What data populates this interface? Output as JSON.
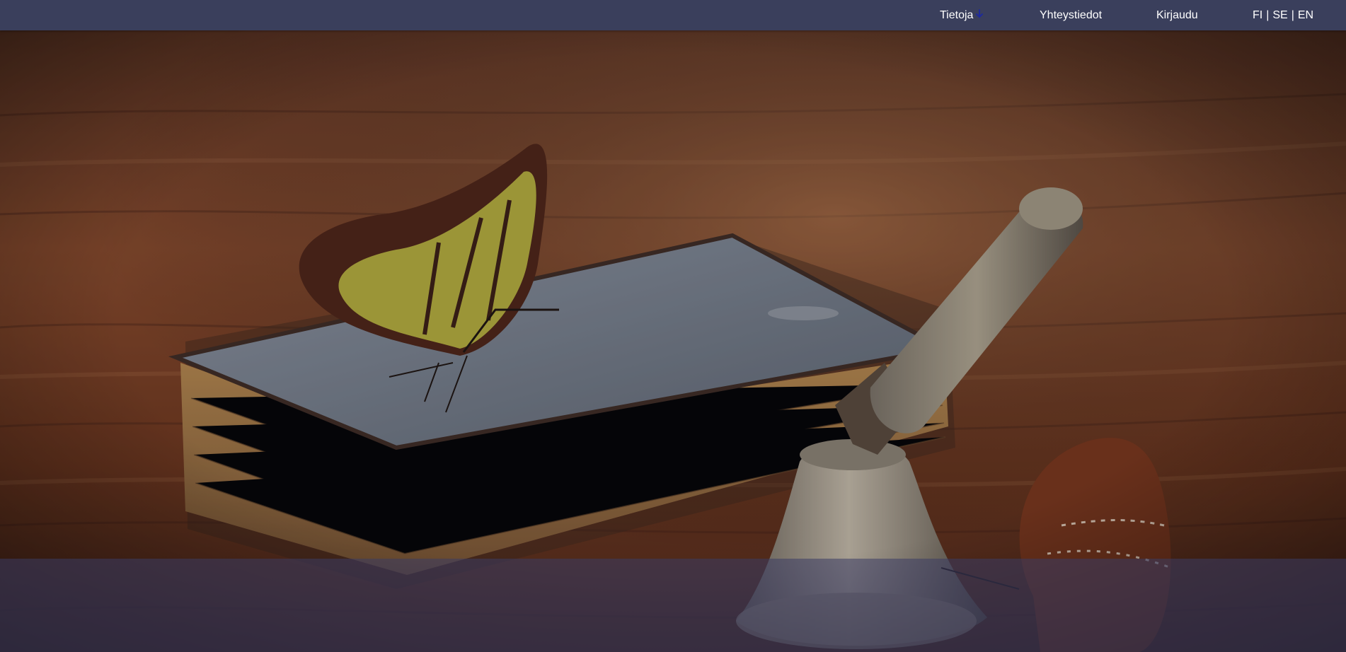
{
  "nav": {
    "items": [
      {
        "label": "Tietoja",
        "icon": "arrow-down-icon"
      },
      {
        "label": "Yhteystiedot"
      },
      {
        "label": "Kirjaudu"
      }
    ],
    "languages": [
      "FI",
      "SE",
      "EN"
    ],
    "language_separator": "|"
  },
  "colors": {
    "topbar": "#3a3f5c",
    "nav_text": "#ffffff",
    "icon_accent": "#1e2a9c",
    "footer_overlay": "#3a3c64"
  },
  "hero": {
    "image": "butterflies-book-bell-photo"
  }
}
